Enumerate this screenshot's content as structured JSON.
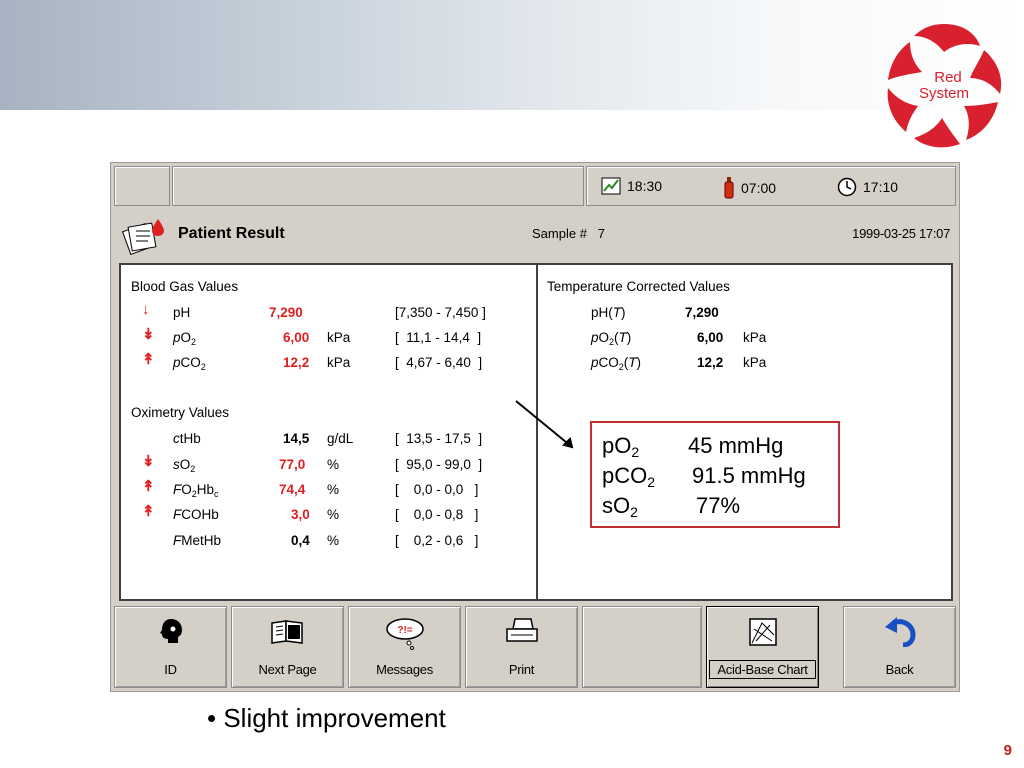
{
  "logo": {
    "line1": "Red",
    "line2": "System"
  },
  "status_bar": {
    "chart_time": "18:30",
    "sample_time": "07:00",
    "clock_time": "17:10"
  },
  "header": {
    "title": "Patient Result",
    "sample_label": "Sample #",
    "sample_number": "7",
    "datetime": "1999-03-25 17:07"
  },
  "blood_gas": {
    "heading": "Blood Gas Values",
    "rows": [
      {
        "name": "pH",
        "value": "7,290",
        "unit": "",
        "range_open": "[",
        "range": "7,350 - 7,450",
        "range_close": "]",
        "flag": "low"
      },
      {
        "name_prefix": "p",
        "name": "O",
        "sub": "2",
        "value": "6,00",
        "unit": "kPa",
        "range_open": "[",
        "range": "11,1 - 14,4",
        "range_close": "]",
        "flag": "critical-low"
      },
      {
        "name_prefix": "p",
        "name": "CO",
        "sub": "2",
        "value": "12,2",
        "unit": "kPa",
        "range_open": "[",
        "range": "4,67 - 6,40",
        "range_close": "]",
        "flag": "critical-high"
      }
    ]
  },
  "oximetry": {
    "heading": "Oximetry Values",
    "rows": [
      {
        "name_prefix": "c",
        "name": "tHb",
        "value": "14,5",
        "unit": "g/dL",
        "range_open": "[",
        "range": "13,5 - 17,5",
        "range_close": "]",
        "flag": "none"
      },
      {
        "name_prefix": "s",
        "name": "O",
        "sub": "2",
        "value": "77,0",
        "unit": "%",
        "range_open": "[",
        "range": "95,0 - 99,0",
        "range_close": "]",
        "flag": "critical-low"
      },
      {
        "name_prefix": "F",
        "name": "O",
        "sub": "2",
        "name_suffix": "Hb",
        "sub2": "c",
        "value": "74,4",
        "unit": "%",
        "range_open": "[",
        "range": "0,0 - 0,0",
        "range_close": "]",
        "flag": "critical-high"
      },
      {
        "name_prefix": "F",
        "name": "COHb",
        "value": "3,0",
        "unit": "%",
        "range_open": "[",
        "range": "0,0 - 0,8",
        "range_close": "]",
        "flag": "critical-high"
      },
      {
        "name_prefix": "F",
        "name": "MetHb",
        "value": "0,4",
        "unit": "%",
        "range_open": "[",
        "range": "0,2 - 0,6",
        "range_close": "]",
        "flag": "none"
      }
    ]
  },
  "temperature_corrected": {
    "heading": "Temperature Corrected Values",
    "rows": [
      {
        "label": "pH(",
        "t": "T",
        "close": ")",
        "value": "7,290",
        "unit": ""
      },
      {
        "label_prefix": "p",
        "label": "O",
        "sub": "2",
        "t": "T",
        "value": "6,00",
        "unit": "kPa"
      },
      {
        "label_prefix": "p",
        "label": "CO",
        "sub": "2",
        "t": "T",
        "value": "12,2",
        "unit": "kPa"
      }
    ]
  },
  "buttons": [
    {
      "label": "ID",
      "icon": "person-head-icon"
    },
    {
      "label": "Next Page",
      "icon": "book-icon"
    },
    {
      "label": "Messages",
      "icon": "thought-bubble-icon"
    },
    {
      "label": "Print",
      "icon": "printer-icon"
    },
    {
      "label": "",
      "icon": ""
    },
    {
      "label": "Acid-Base Chart",
      "icon": "acid-base-chart-icon"
    },
    {
      "label": "Back",
      "icon": "back-arrow-icon"
    }
  ],
  "callout": {
    "rows": [
      {
        "name": "pO",
        "sub": "2",
        "value": "45 mmHg"
      },
      {
        "name": "pCO",
        "sub": "2",
        "value": "91.5 mmHg"
      },
      {
        "name": "sO",
        "sub": "2",
        "value": "77%"
      }
    ]
  },
  "bullet": "• Slight improvement",
  "page_number": "9",
  "colors": {
    "abnormal": "#e02020",
    "callout_border": "#c03030",
    "logo_red": "#d9202f"
  }
}
